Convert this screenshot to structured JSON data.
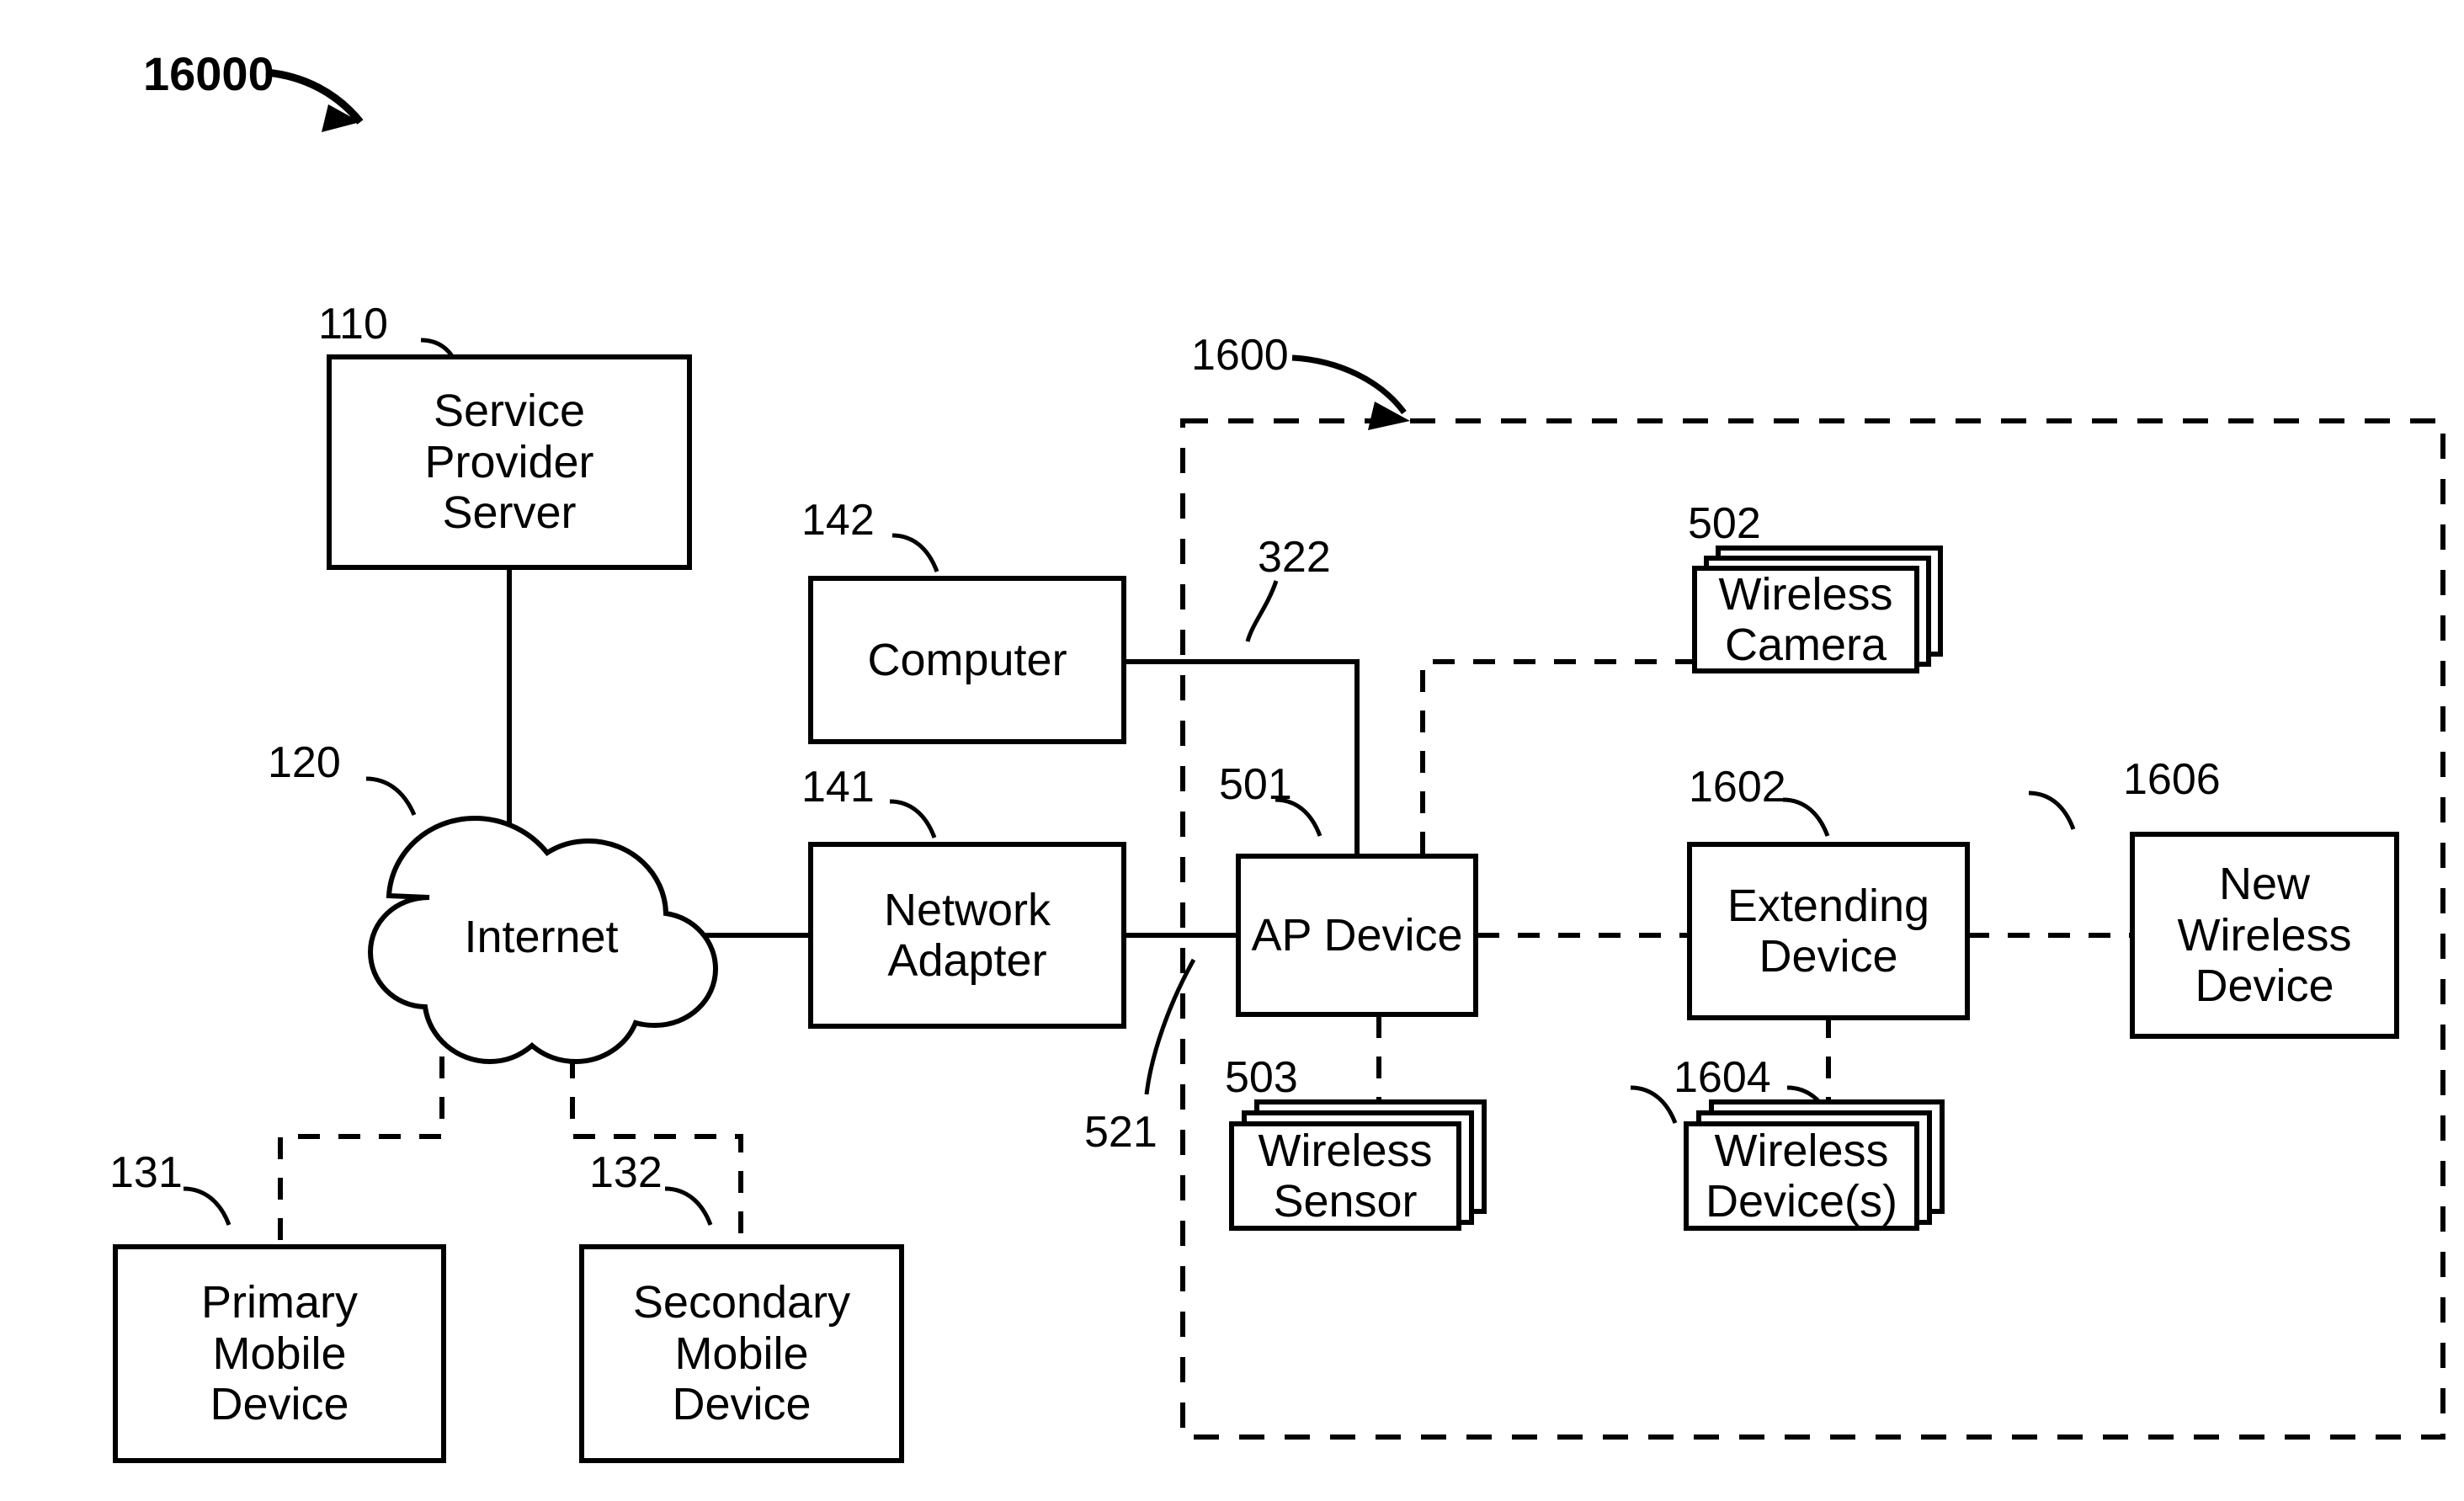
{
  "figure": {
    "id_label": "16000",
    "region_label": "1600"
  },
  "nodes": {
    "service_provider_server": {
      "ref": "110",
      "label": "Service\nProvider\nServer"
    },
    "internet": {
      "ref": "120",
      "label": "Internet"
    },
    "primary_mobile_device": {
      "ref": "131",
      "label": "Primary\nMobile\nDevice"
    },
    "secondary_mobile_device": {
      "ref": "132",
      "label": "Secondary\nMobile\nDevice"
    },
    "computer": {
      "ref": "142",
      "label": "Computer"
    },
    "network_adapter": {
      "ref": "141",
      "label": "Network\nAdapter"
    },
    "ap_device": {
      "ref": "501",
      "label": "AP Device"
    },
    "wireless_camera": {
      "ref": "502",
      "label": "Wireless\nCamera"
    },
    "wireless_sensor": {
      "ref": "503",
      "label": "Wireless\nSensor"
    },
    "extending_device": {
      "ref": "1602",
      "label": "Extending\nDevice"
    },
    "wireless_devices": {
      "ref": "1604",
      "label": "Wireless\nDevice(s)"
    },
    "new_wireless_device": {
      "ref": "1606",
      "label": "New\nWireless\nDevice"
    }
  },
  "connections": {
    "computer_to_ap": {
      "ref": "322"
    },
    "adapter_to_ap": {
      "ref": "521"
    }
  },
  "colors": {
    "stroke": "#000000",
    "background": "#ffffff"
  }
}
